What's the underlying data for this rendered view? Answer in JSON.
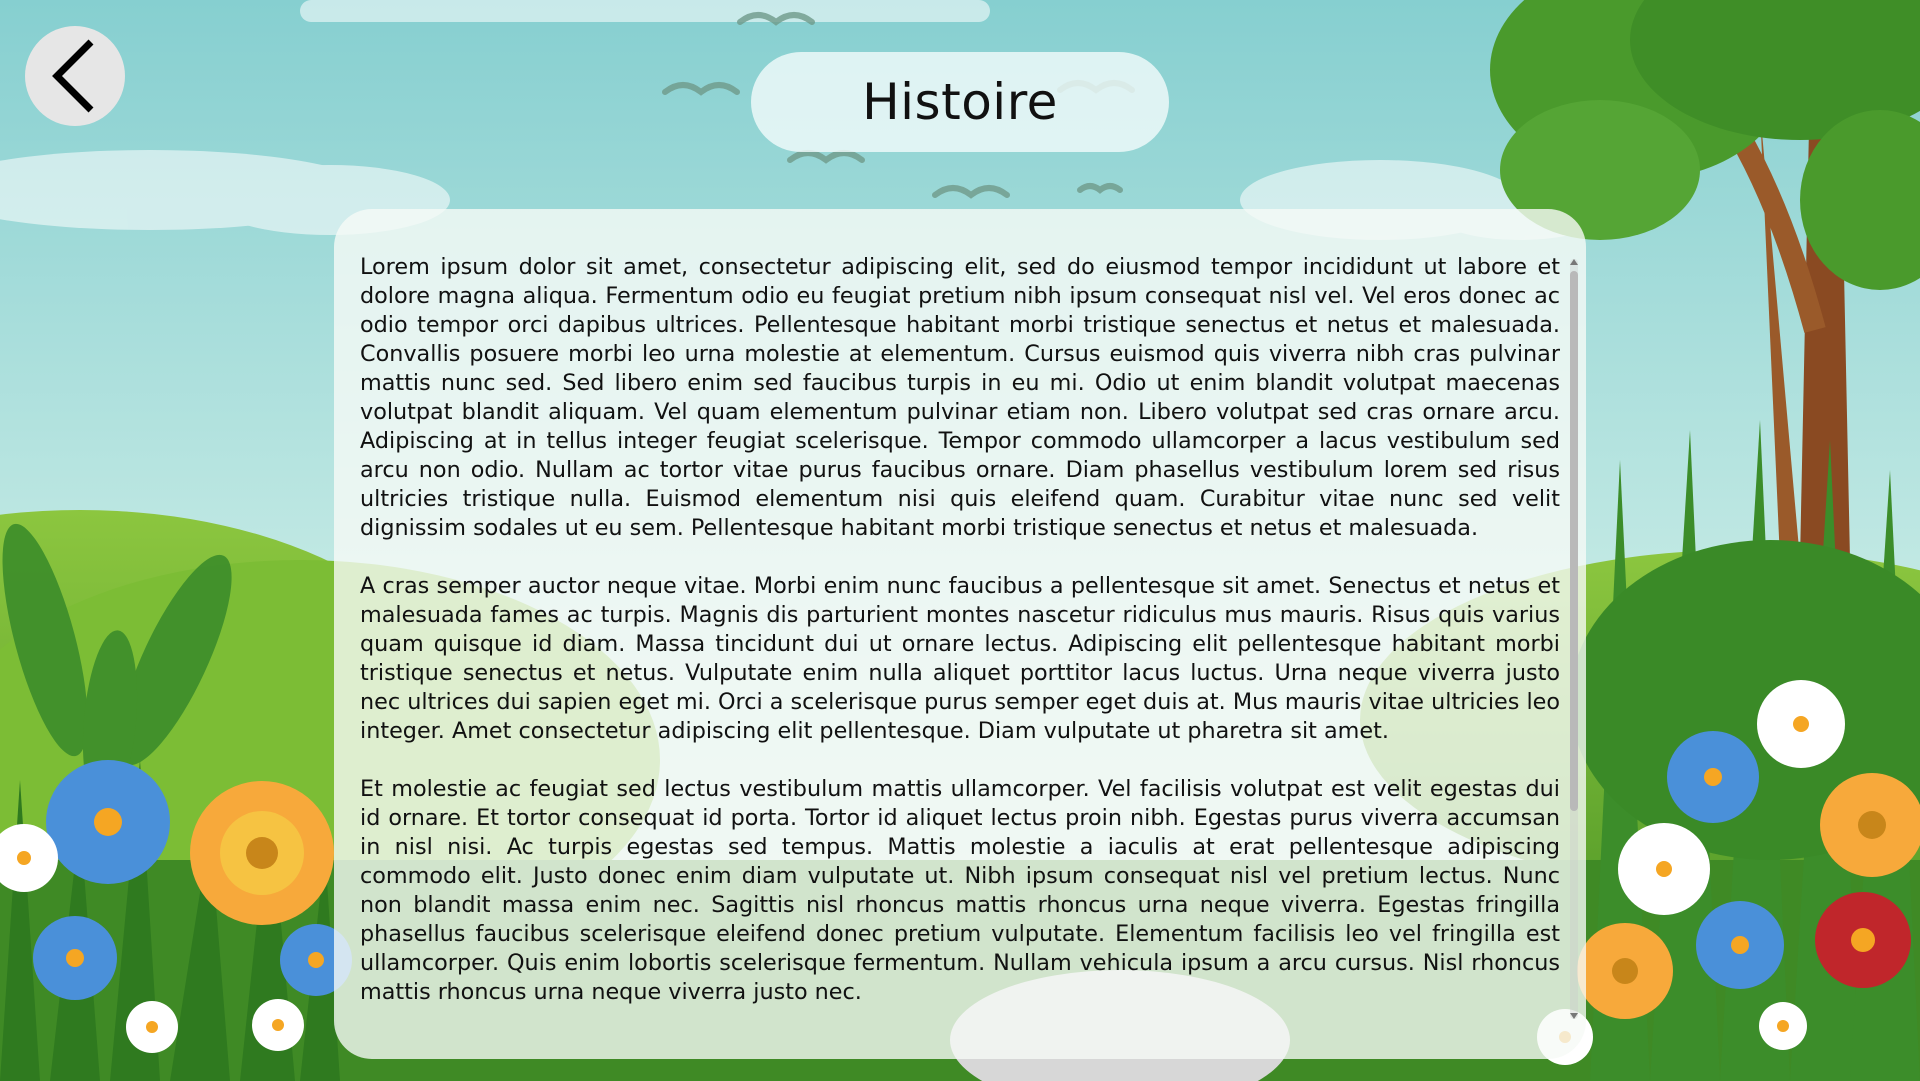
{
  "header": {
    "title": "Histoire",
    "back_icon": "chevron-left-icon"
  },
  "story": {
    "paragraphs": [
      "Lorem ipsum dolor sit amet, consectetur adipiscing elit, sed do eiusmod tempor incididunt ut labore et dolore magna aliqua. Fermentum odio eu feugiat pretium nibh ipsum consequat nisl vel. Vel eros donec ac odio tempor orci dapibus ultrices. Pellentesque habitant morbi tristique senectus et netus et malesuada. Convallis posuere morbi leo urna molestie at elementum. Cursus euismod quis viverra nibh cras pulvinar mattis nunc sed. Sed libero enim sed faucibus turpis in eu mi. Odio ut enim blandit volutpat maecenas volutpat blandit aliquam. Vel quam elementum pulvinar etiam non. Libero volutpat sed cras ornare arcu. Adipiscing at in tellus integer feugiat scelerisque. Tempor commodo ullamcorper a lacus vestibulum sed arcu non odio. Nullam ac tortor vitae purus faucibus ornare. Diam phasellus vestibulum lorem sed risus ultricies tristique nulla. Euismod elementum nisi quis eleifend quam. Curabitur vitae nunc sed velit dignissim sodales ut eu sem. Pellentesque habitant morbi tristique senectus et netus et malesuada.",
      "A cras semper auctor neque vitae. Morbi enim nunc faucibus a pellentesque sit amet. Senectus et netus et malesuada fames ac turpis. Magnis dis parturient montes nascetur ridiculus mus mauris. Risus quis varius quam quisque id diam. Massa tincidunt dui ut ornare lectus. Adipiscing elit pellentesque habitant morbi tristique senectus et netus. Vulputate enim nulla aliquet porttitor lacus luctus. Urna neque viverra justo nec ultrices dui sapien eget mi. Orci a scelerisque purus semper eget duis at. Mus mauris vitae ultricies leo integer. Amet consectetur adipiscing elit pellentesque. Diam vulputate ut pharetra sit amet.",
      "Et molestie ac feugiat sed lectus vestibulum mattis ullamcorper. Vel facilisis volutpat est velit egestas dui id ornare. Et tortor consequat id porta. Tortor id aliquet lectus proin nibh. Egestas purus viverra accumsan in nisl nisi. Ac turpis egestas sed tempus. Mattis molestie a iaculis at erat pellentesque adipiscing commodo elit. Justo donec enim diam vulputate ut. Nibh ipsum consequat nisl vel pretium lectus. Nunc non blandit massa enim nec. Sagittis nisl rhoncus mattis rhoncus urna neque viverra. Egestas fringilla phasellus faucibus scelerisque eleifend donec pretium vulputate. Elementum facilisis leo vel fringilla est ullamcorper. Quis enim lobortis scelerisque fermentum. Nullam vehicula ipsum a arcu cursus. Nisl rhoncus mattis rhoncus urna neque viverra justo nec."
    ]
  },
  "colors": {
    "sky_top": "#8fd3d3",
    "sky_bottom": "#c8ece6",
    "grass": "#4f9a2a",
    "tree_leaves": "#4a9a2c",
    "tree_trunk": "#9a5a2a",
    "panel_bg": "#f6faf6"
  }
}
